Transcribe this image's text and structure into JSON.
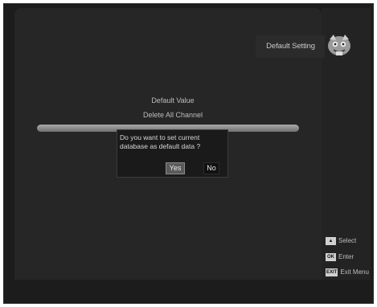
{
  "header": {
    "title": "Default Setting"
  },
  "menu": {
    "items": [
      {
        "label": "Default Value"
      },
      {
        "label": "Delete All Channel"
      }
    ]
  },
  "dialog": {
    "message": "Do you want to set current database as default data ?",
    "buttons": {
      "yes": "Yes",
      "no": "No"
    }
  },
  "legend": {
    "items": [
      {
        "key": "▲",
        "label": "Select"
      },
      {
        "key": "OK",
        "label": "Enter"
      },
      {
        "key": "EXIT",
        "label": "Exit Menu"
      }
    ]
  },
  "icons": {
    "logo": "mascot-logo-icon"
  }
}
